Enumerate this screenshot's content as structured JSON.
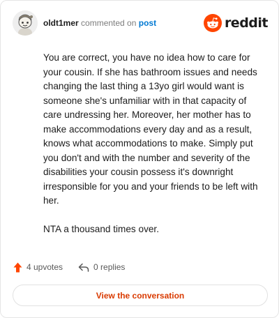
{
  "header": {
    "username": "oldt1mer",
    "action": "commented on",
    "target": "post",
    "brand": "reddit"
  },
  "comment": {
    "paragraphs": [
      "You are correct, you have no idea how to care for your cousin. If she has bathroom issues and needs changing the last thing a 13yo girl would want is someone she's unfamiliar with in that capacity of care undressing her. Moreover, her mother has to make accommodations every day and as a result, knows what accommodations to make. Simply put you don't and with the number and severity of the disabilities your cousin possess it's downright irresponsible for you and your friends to be left with her.",
      "NTA a thousand times over."
    ]
  },
  "stats": {
    "upvotes": "4 upvotes",
    "replies": "0 replies"
  },
  "cta": {
    "label": "View the conversation"
  },
  "colors": {
    "brand_orange": "#ff4500",
    "link_blue": "#0079d3",
    "cta_text": "#d93a00"
  },
  "icons": {
    "avatar": "snoo-avatar",
    "logo": "reddit-snoo-icon",
    "upvote": "upvote-arrow-icon",
    "reply": "reply-arrow-icon"
  }
}
